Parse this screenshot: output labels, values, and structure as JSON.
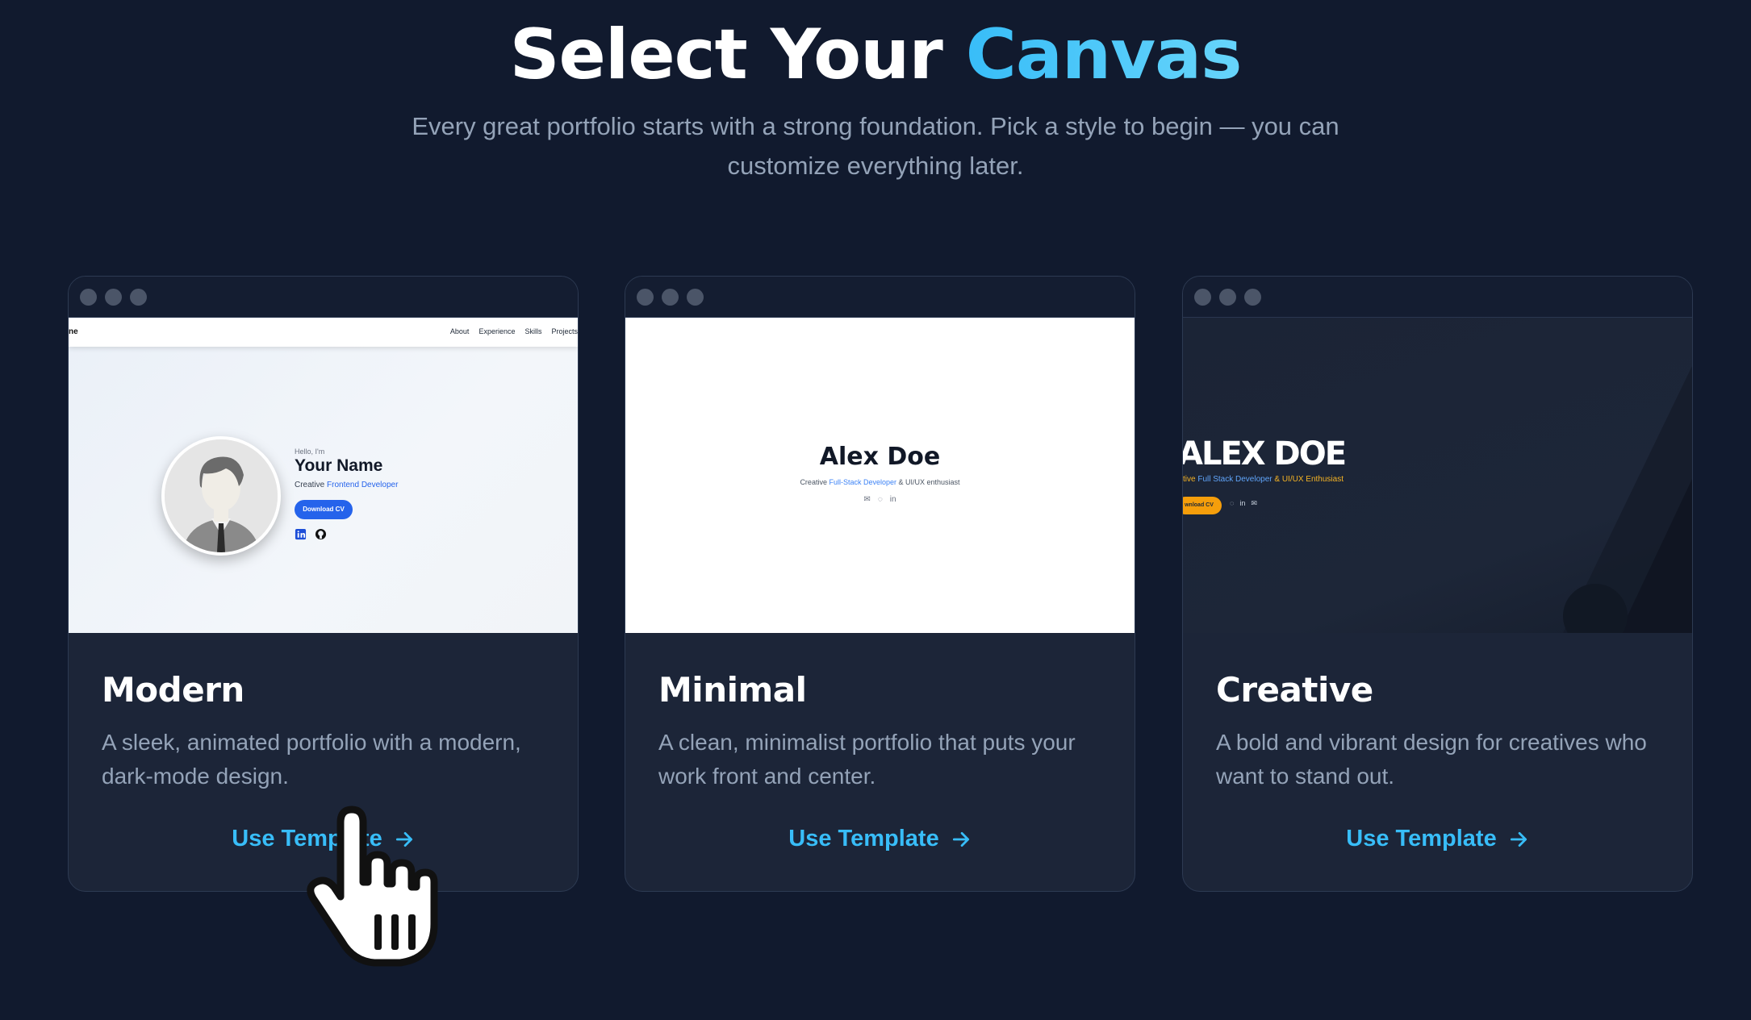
{
  "header": {
    "title_main": "Select Your",
    "title_accent": "Canvas",
    "subtitle": "Every great portfolio starts with a strong foundation. Pick a style to begin — you can customize everything later."
  },
  "colors": {
    "background": "#111a2e",
    "card_background": "#1c2538",
    "accent": "#38bdf8",
    "muted_text": "#94a3b8"
  },
  "templates": [
    {
      "title": "Modern",
      "description": "A sleek, animated portfolio with a modern, dark-mode design.",
      "cta": "Use Template",
      "preview": {
        "brand": "ne",
        "nav": [
          "About",
          "Experience",
          "Skills",
          "Projects"
        ],
        "greeting": "Hello, I'm",
        "name": "Your Name",
        "role_prefix": "Creative",
        "role_highlight": "Frontend Developer",
        "button": "Download CV"
      }
    },
    {
      "title": "Minimal",
      "description": "A clean, minimalist portfolio that puts your work front and center.",
      "cta": "Use Template",
      "preview": {
        "name": "Alex Doe",
        "role_prefix": "Creative",
        "role_highlight": "Full-Stack Developer",
        "role_suffix": "& UI/UX enthusiast"
      }
    },
    {
      "title": "Creative",
      "description": "A bold and vibrant design for creatives who want to stand out.",
      "cta": "Use Template",
      "preview": {
        "name": "ALEX DOE",
        "role_prefix": "tive",
        "role_highlight": "Full Stack Developer",
        "role_suffix": "& UI/UX Enthusiast",
        "button": "wnload CV"
      }
    }
  ]
}
